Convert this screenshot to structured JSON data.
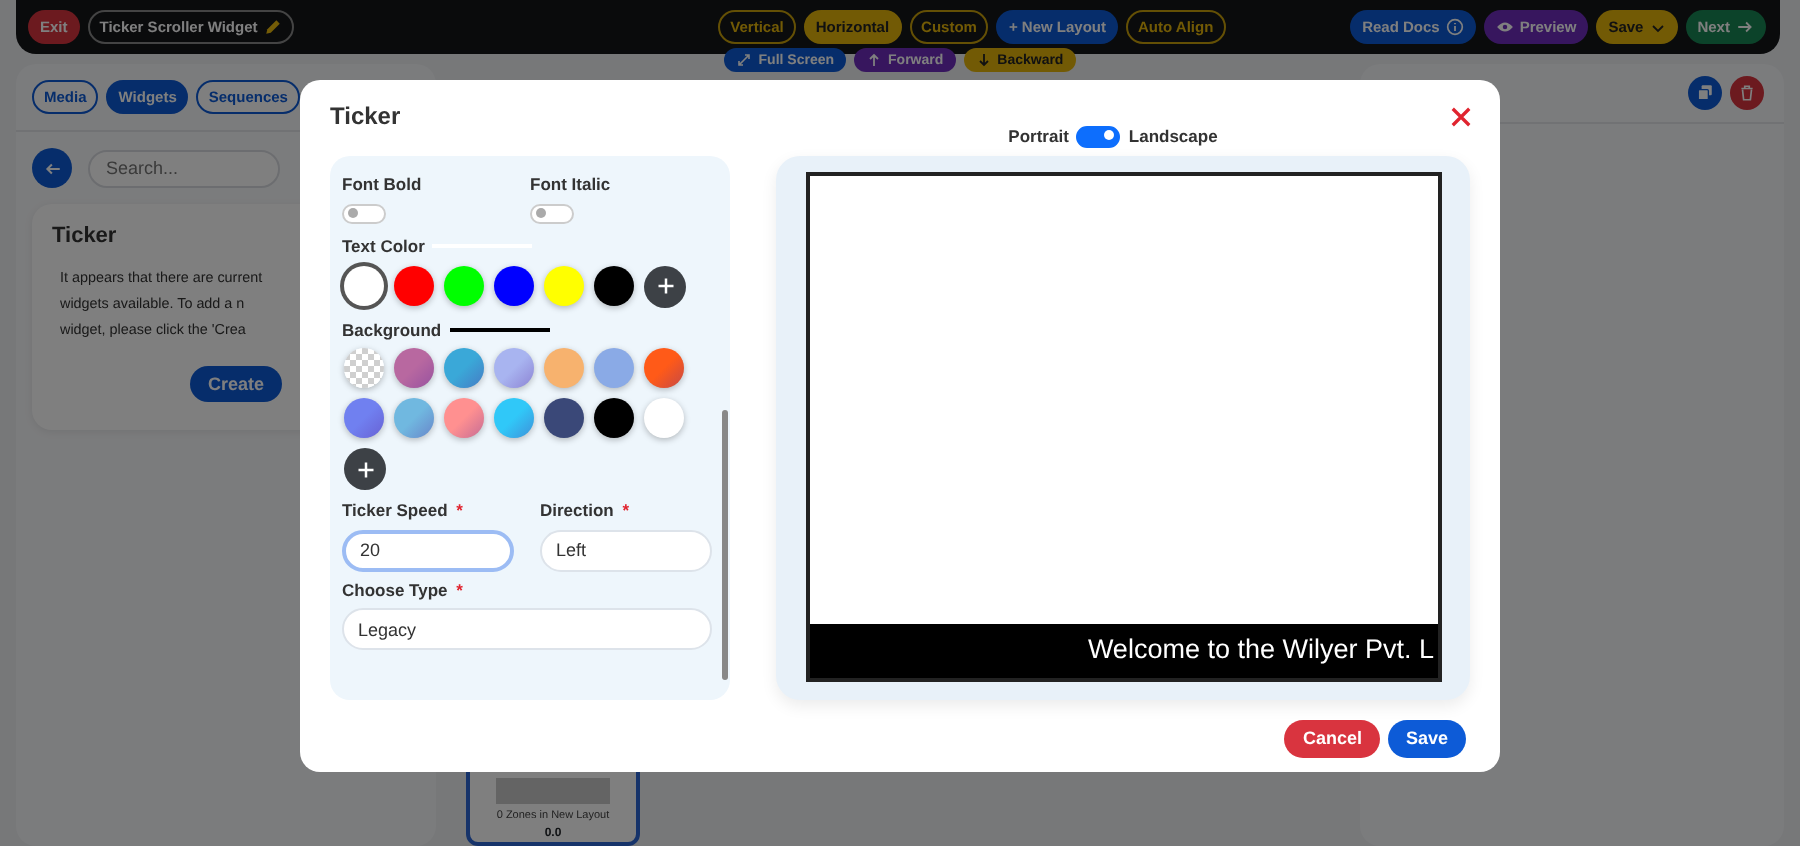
{
  "top_bar": {
    "exit_button": "Exit",
    "widget_name": "Ticker Scroller Widget",
    "orientations": [
      {
        "label": "Vertical",
        "selected": false
      },
      {
        "label": "Horizontal",
        "selected": true
      },
      {
        "label": "Custom",
        "selected": false
      }
    ],
    "new_layout_button": "+ New Layout",
    "auto_align_button": "Auto Align",
    "read_docs_button": "Read Docs",
    "preview_button": "Preview",
    "save_button": "Save",
    "next_button": "Next"
  },
  "sidebar": {
    "tabs": [
      {
        "label": "Media",
        "selected": false
      },
      {
        "label": "Widgets",
        "selected": true
      },
      {
        "label": "Sequences",
        "selected": false
      }
    ],
    "search": {
      "placeholder": "Search..."
    },
    "card": {
      "title": "Ticker",
      "message_lines": [
        "It appears that there are current",
        "widgets available. To add a n",
        "widget, please click the 'Crea"
      ],
      "button": "Create"
    }
  },
  "canvas_toolbar": [
    {
      "kind": "fullscreen",
      "label": "Full Screen"
    },
    {
      "kind": "forward",
      "label": "Forward"
    },
    {
      "kind": "backward",
      "label": "Backward"
    }
  ],
  "layout_thumbnail": {
    "caption": "0 Zones in New Layout",
    "value": "0.0"
  },
  "dialog": {
    "title": "Ticker",
    "font_bold": {
      "label": "Font Bold",
      "on": false
    },
    "font_italic": {
      "label": "Font Italic",
      "on": false
    },
    "text_color": {
      "label": "Text Color",
      "color": "#ffffff",
      "swatches": [
        {
          "color": "#ffffff",
          "selected": true
        },
        {
          "color": "#ff0000",
          "selected": false
        },
        {
          "color": "#00ff00",
          "selected": false
        },
        {
          "color": "#0000ff",
          "selected": false
        },
        {
          "color": "#ffff00",
          "selected": false
        },
        {
          "color": "#000000",
          "selected": false
        }
      ]
    },
    "background": {
      "label": "Background",
      "color": "#000000",
      "swatches": [
        {
          "kind": "checker",
          "selected": false
        },
        {
          "kind": "gradient",
          "color": "#b868a0",
          "selected": false
        },
        {
          "kind": "gradient",
          "color": "#3aa8d8",
          "selected": false
        },
        {
          "kind": "gradient",
          "color": "#a8b4f0",
          "selected": false
        },
        {
          "kind": "solid",
          "color": "#f7b26e",
          "selected": false
        },
        {
          "kind": "solid",
          "color": "#8aaae6",
          "selected": false
        },
        {
          "kind": "gradient",
          "color": "#ff5a18",
          "selected": false
        },
        {
          "kind": "gradient",
          "color": "#7080f0",
          "selected": false
        },
        {
          "kind": "gradient",
          "color": "#70b8e0",
          "selected": false
        },
        {
          "kind": "gradient",
          "color": "#ff9090",
          "selected": false
        },
        {
          "kind": "gradient",
          "color": "#30c8f8",
          "selected": false
        },
        {
          "kind": "solid",
          "color": "#3a4878",
          "selected": false
        },
        {
          "kind": "solid",
          "color": "#000000",
          "selected": false
        },
        {
          "kind": "solid",
          "color": "#ffffff",
          "selected": false
        }
      ]
    },
    "ticker_speed": {
      "label": "Ticker Speed",
      "required_mark": "*",
      "value": "20"
    },
    "direction": {
      "label": "Direction",
      "required_mark": "*",
      "value": "Left"
    },
    "choose_type": {
      "label": "Choose Type",
      "required_mark": "*",
      "value": "Legacy"
    },
    "orientation": {
      "left_label": "Portrait",
      "right_label": "Landscape",
      "on": true
    },
    "preview": {
      "ticker_text": "Welcome to the Wilyer Pvt. L"
    },
    "cancel_button": "Cancel",
    "save_button": "Save"
  }
}
